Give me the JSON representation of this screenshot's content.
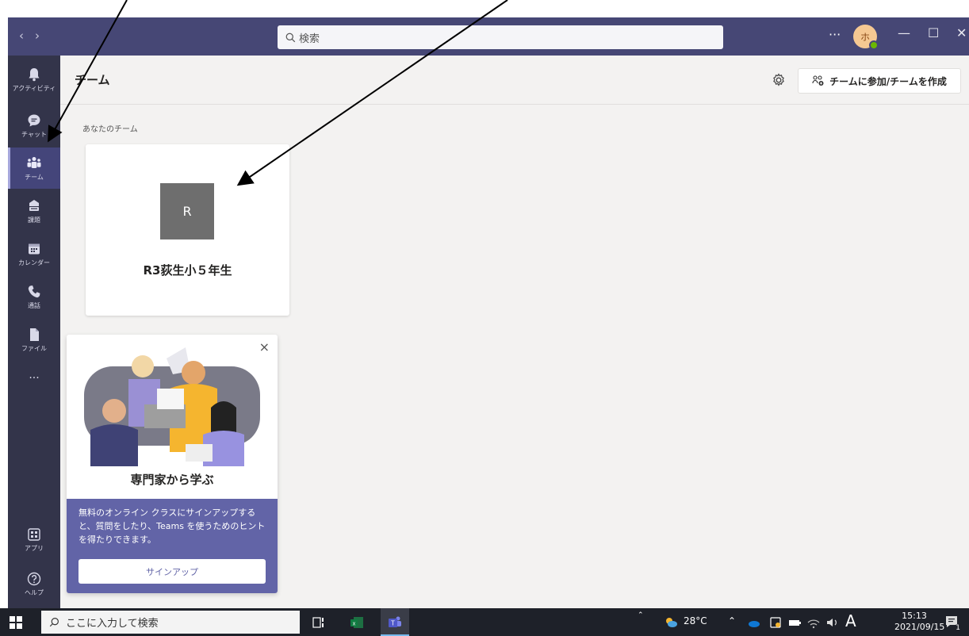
{
  "titlebar": {
    "back_glyph": "‹",
    "forward_glyph": "›",
    "search_placeholder": "検索",
    "more_glyph": "···",
    "avatar_initial": "ホ",
    "minimize_glyph": "—",
    "maximize_glyph": "☐",
    "close_glyph": "✕"
  },
  "rail": {
    "items": [
      {
        "label": "アクティビティ",
        "icon": "bell-icon"
      },
      {
        "label": "チャット",
        "icon": "chat-icon"
      },
      {
        "label": "チーム",
        "icon": "teams-icon",
        "active": true
      },
      {
        "label": "課題",
        "icon": "assignments-icon"
      },
      {
        "label": "カレンダー",
        "icon": "calendar-icon"
      },
      {
        "label": "通話",
        "icon": "phone-icon"
      },
      {
        "label": "ファイル",
        "icon": "file-icon"
      }
    ],
    "more_glyph": "···",
    "apps_label": "アプリ",
    "help_label": "ヘルプ"
  },
  "main": {
    "title": "チーム",
    "join_button": "チームに参加/チームを作成",
    "section_label": "あなたのチーム",
    "team": {
      "initial": "R",
      "name": "R3荻生小５年生",
      "tile_color": "#6e6e6e"
    }
  },
  "promo": {
    "close_glyph": "×",
    "title": "専門家から学ぶ",
    "description": "無料のオンライン クラスにサインアップすると、質問をしたり、Teams を使うためのヒントを得たりできます。",
    "signup_button": "サインアップ"
  },
  "taskbar": {
    "search_placeholder": "ここに入力して検索",
    "temperature": "28°C",
    "ime": "A",
    "time": "15:13",
    "date": "2021/09/15",
    "notification_count": "1"
  },
  "colors": {
    "titlebar": "#464775",
    "rail": "#33344a",
    "accent": "#6264a7",
    "background": "#f3f2f1"
  }
}
